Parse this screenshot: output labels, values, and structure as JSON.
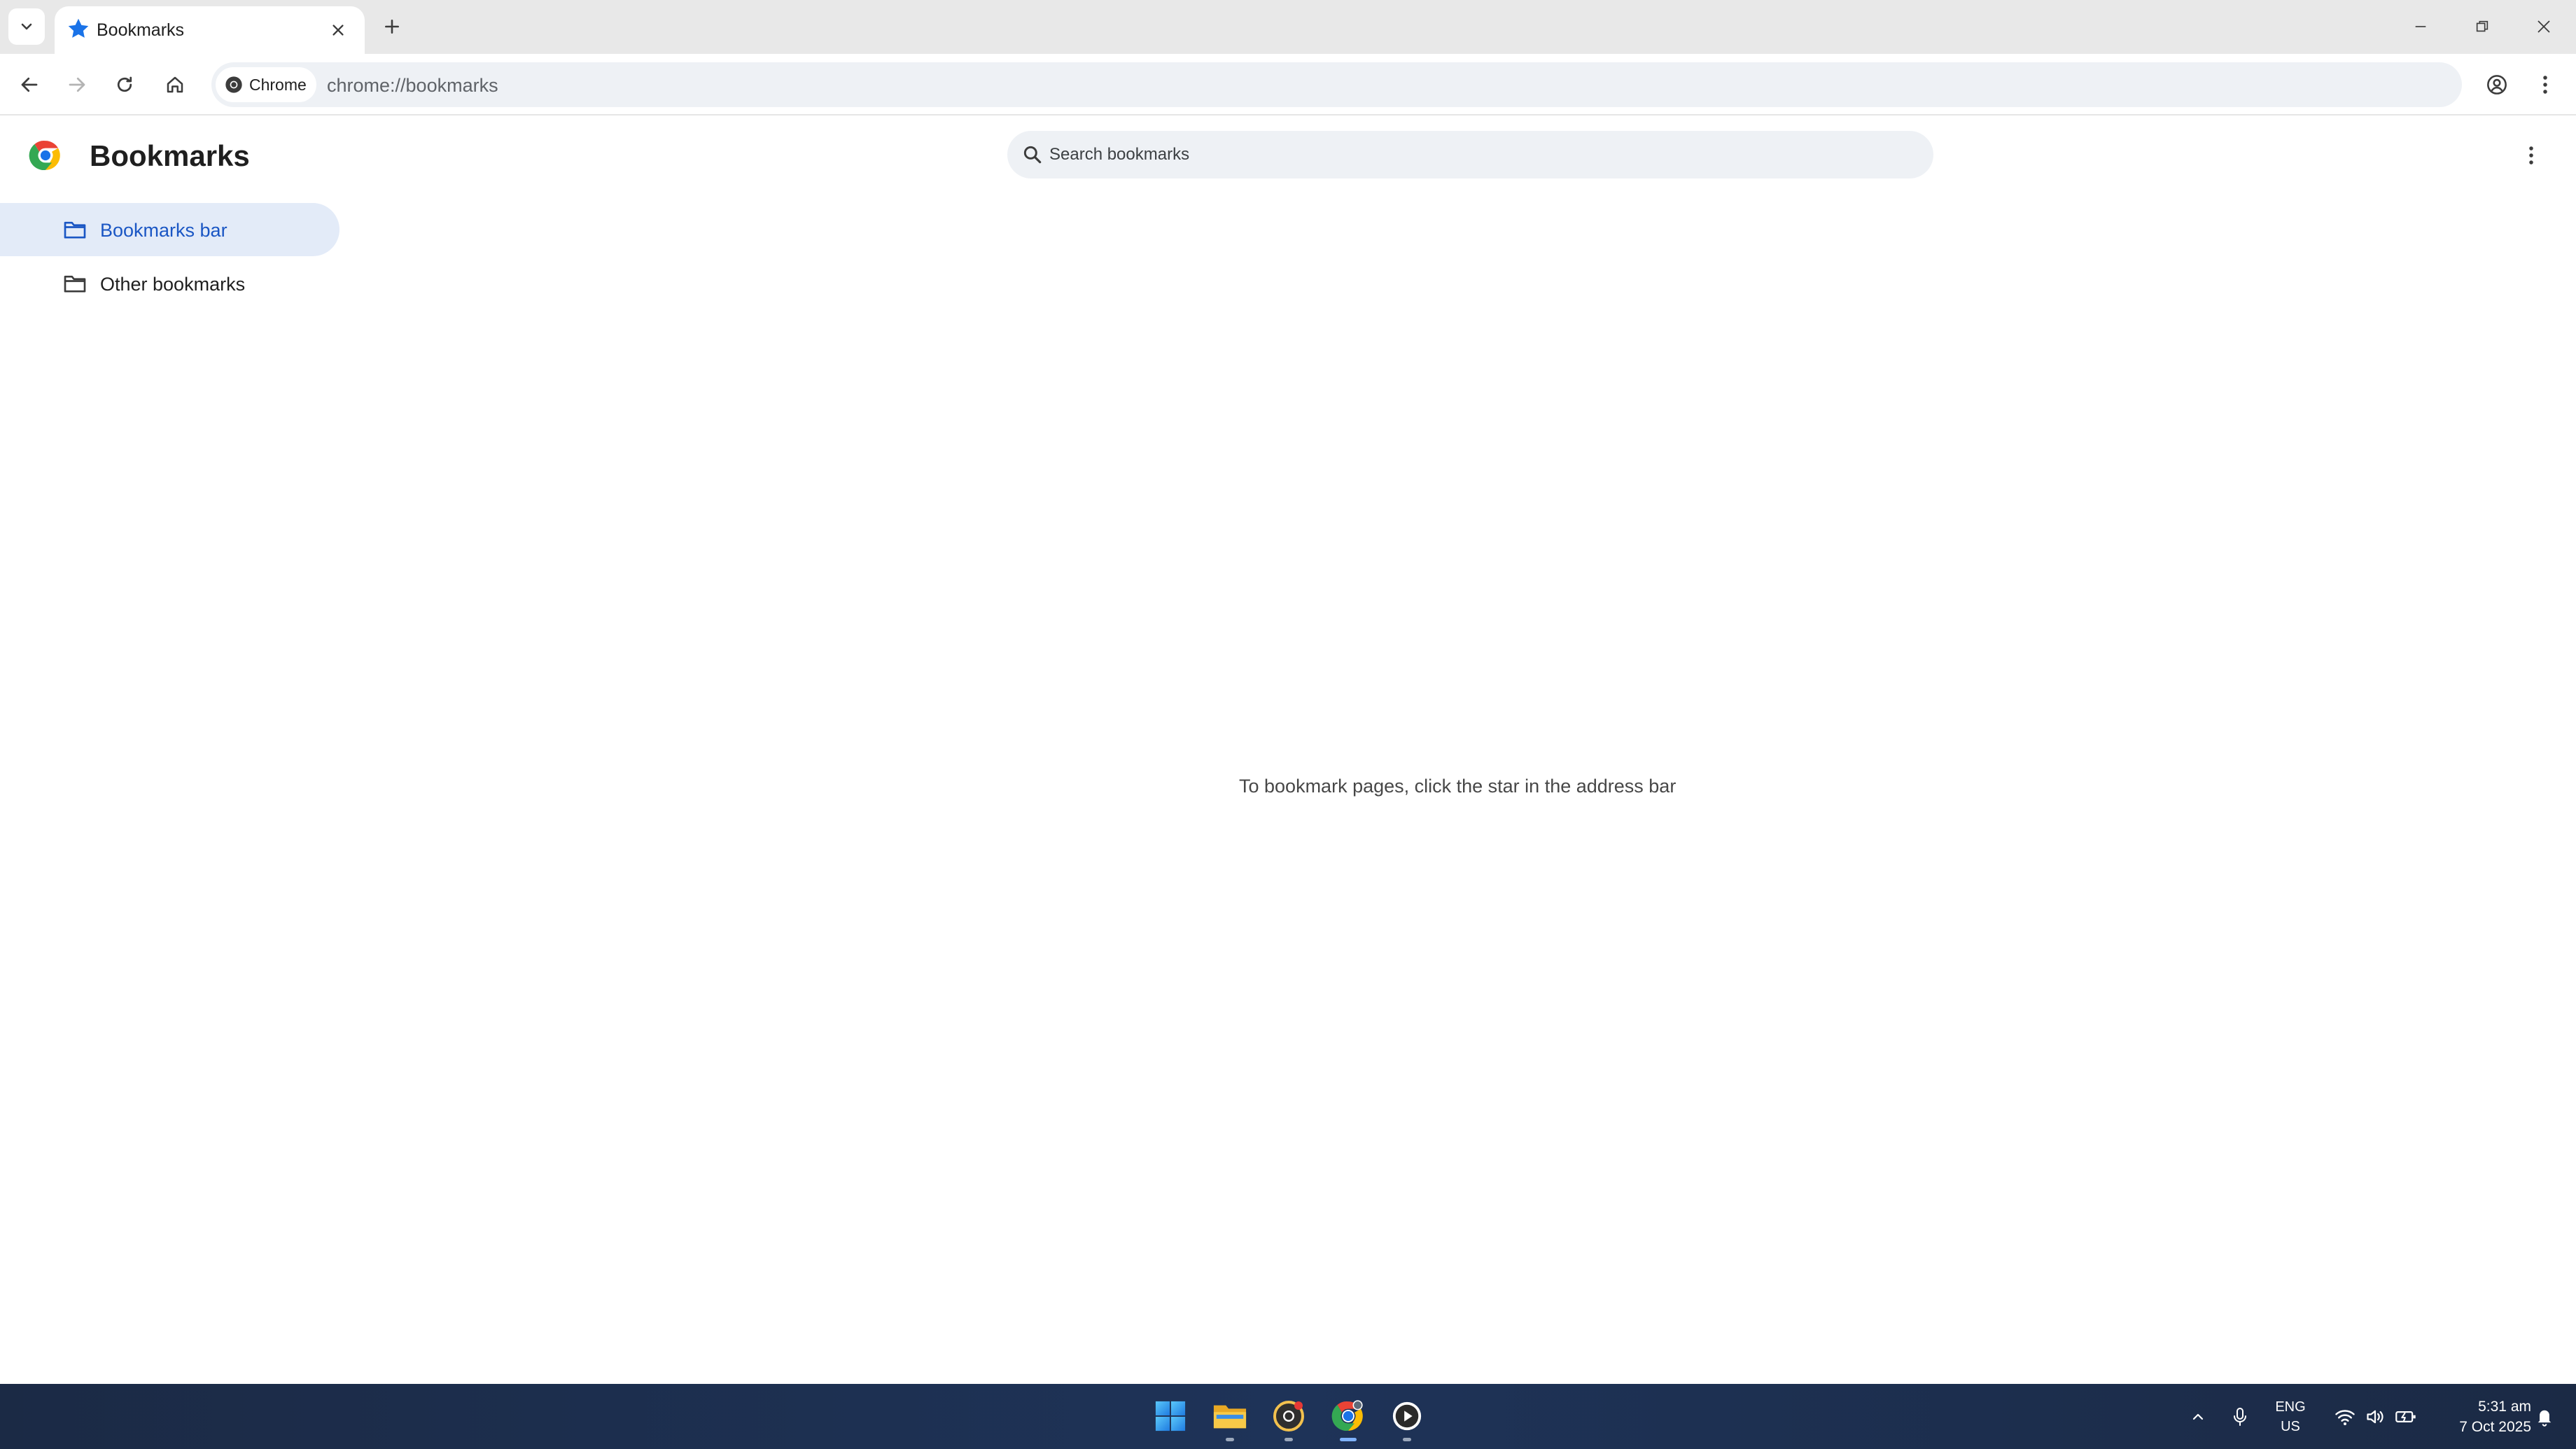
{
  "browser": {
    "tab": {
      "title": "Bookmarks"
    },
    "omnibox": {
      "chip_label": "Chrome",
      "url": "chrome://bookmarks"
    }
  },
  "page": {
    "title": "Bookmarks",
    "search": {
      "placeholder": "Search bookmarks",
      "value": ""
    },
    "sidebar": {
      "items": [
        {
          "label": "Bookmarks bar",
          "selected": true
        },
        {
          "label": "Other bookmarks",
          "selected": false
        }
      ]
    },
    "empty_message": "To bookmark pages, click the star in the address bar"
  },
  "taskbar": {
    "apps": [
      "start-icon",
      "file-explorer-icon",
      "chrome-canary-icon",
      "chrome-icon",
      "media-player-icon"
    ],
    "language": {
      "line1": "ENG",
      "line2": "US"
    },
    "clock": {
      "time": "5:31 am",
      "date": "7 Oct 2025"
    }
  },
  "colors": {
    "accent": "#1a56c4",
    "selected_bg": "#e3ebf8",
    "omnibox_bg": "#eef1f5",
    "taskbar_bg": "#1e3358"
  }
}
